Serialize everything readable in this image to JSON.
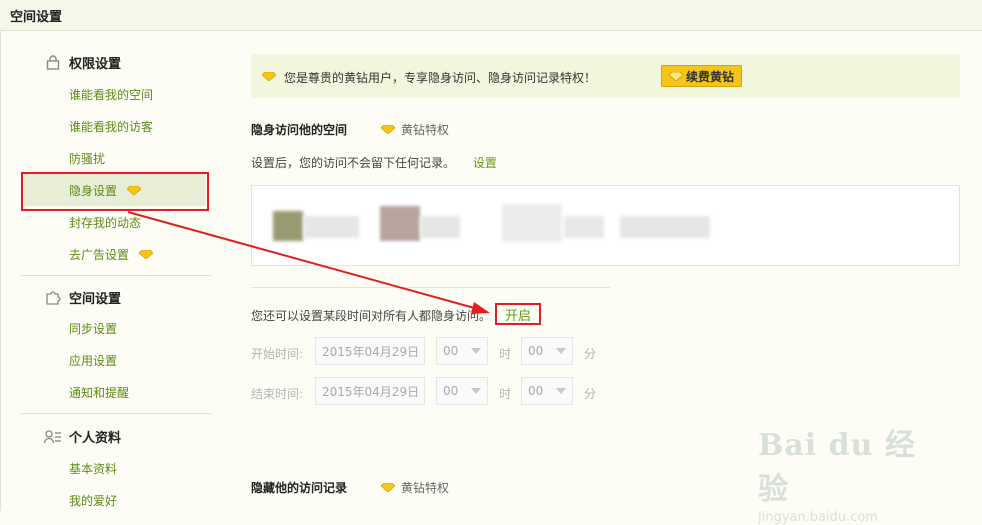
{
  "header": {
    "title": "空间设置"
  },
  "sidebar": {
    "sections": [
      {
        "title": "权限设置",
        "icon": "lock-icon",
        "items": [
          "谁能看我的空间",
          "谁能看我的访客",
          "防骚扰",
          "隐身设置",
          "封存我的动态",
          "去广告设置"
        ]
      },
      {
        "title": "空间设置",
        "icon": "puzzle-icon",
        "items": [
          "同步设置",
          "应用设置",
          "通知和提醒"
        ]
      },
      {
        "title": "个人资料",
        "icon": "profile-icon",
        "items": [
          "基本资料",
          "我的爱好"
        ]
      }
    ],
    "active_item": "隐身设置"
  },
  "notice": {
    "text": "您是尊贵的黄钻用户，专享隐身访问、隐身访问记录特权！",
    "button": "续费黄钻"
  },
  "invisible_visit": {
    "title": "隐身访问他的空间",
    "privilege": "黄钻特权",
    "desc": "设置后，您的访问不会留下任何记录。",
    "set_link": "设置"
  },
  "schedule": {
    "text": "您还可以设置某段时间对所有人都隐身访问。",
    "open": "开启",
    "start_label": "开始时间:",
    "end_label": "结束时间:",
    "start_date": "2015年04月29日",
    "end_date": "2015年04月29日",
    "hour": "00",
    "minute": "00",
    "hour_unit": "时",
    "minute_unit": "分"
  },
  "hide_records": {
    "title": "隐藏他的访问记录",
    "privilege": "黄钻特权"
  },
  "watermark": {
    "logo": "Bai du 经验",
    "url": "jingyan.baidu.com"
  },
  "colors": {
    "accent_green": "#6a9a1a",
    "diamond_yellow": "#f5c518",
    "annotation_red": "#e02020"
  }
}
